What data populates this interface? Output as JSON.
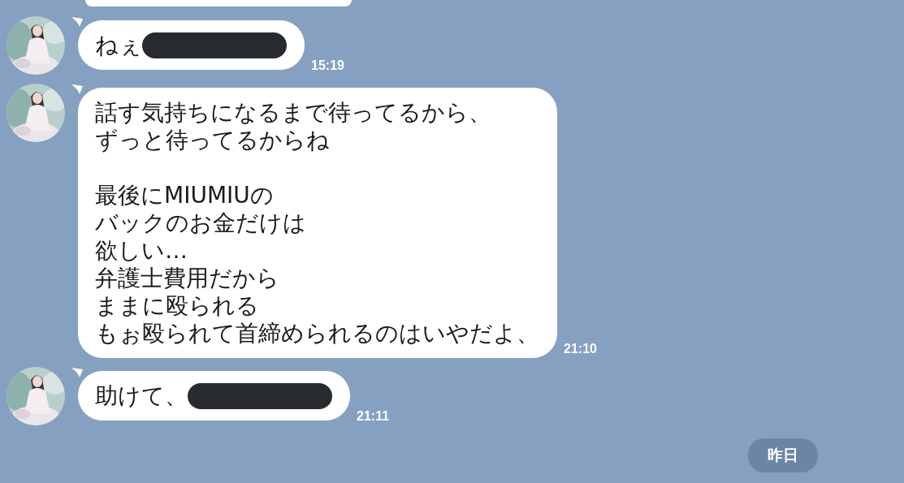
{
  "messages": [
    {
      "paragraphs": [
        [
          "ねぇ"
        ]
      ],
      "redacted": true,
      "time": "15:19"
    },
    {
      "paragraphs": [
        [
          "話す気持ちになるまで待ってるから、",
          "ずっと待ってるからね"
        ],
        [
          "最後にMIUMIUの",
          "バックのお金だけは",
          "欲しい…",
          "弁護士費用だから",
          "ままに殴られる",
          "もぉ殴られて首締められるのはいやだよ、"
        ]
      ],
      "redacted": false,
      "time": "21:10"
    },
    {
      "paragraphs": [
        [
          "助けて、"
        ]
      ],
      "redacted": true,
      "time": "21:11"
    }
  ],
  "date_divider": "昨日"
}
